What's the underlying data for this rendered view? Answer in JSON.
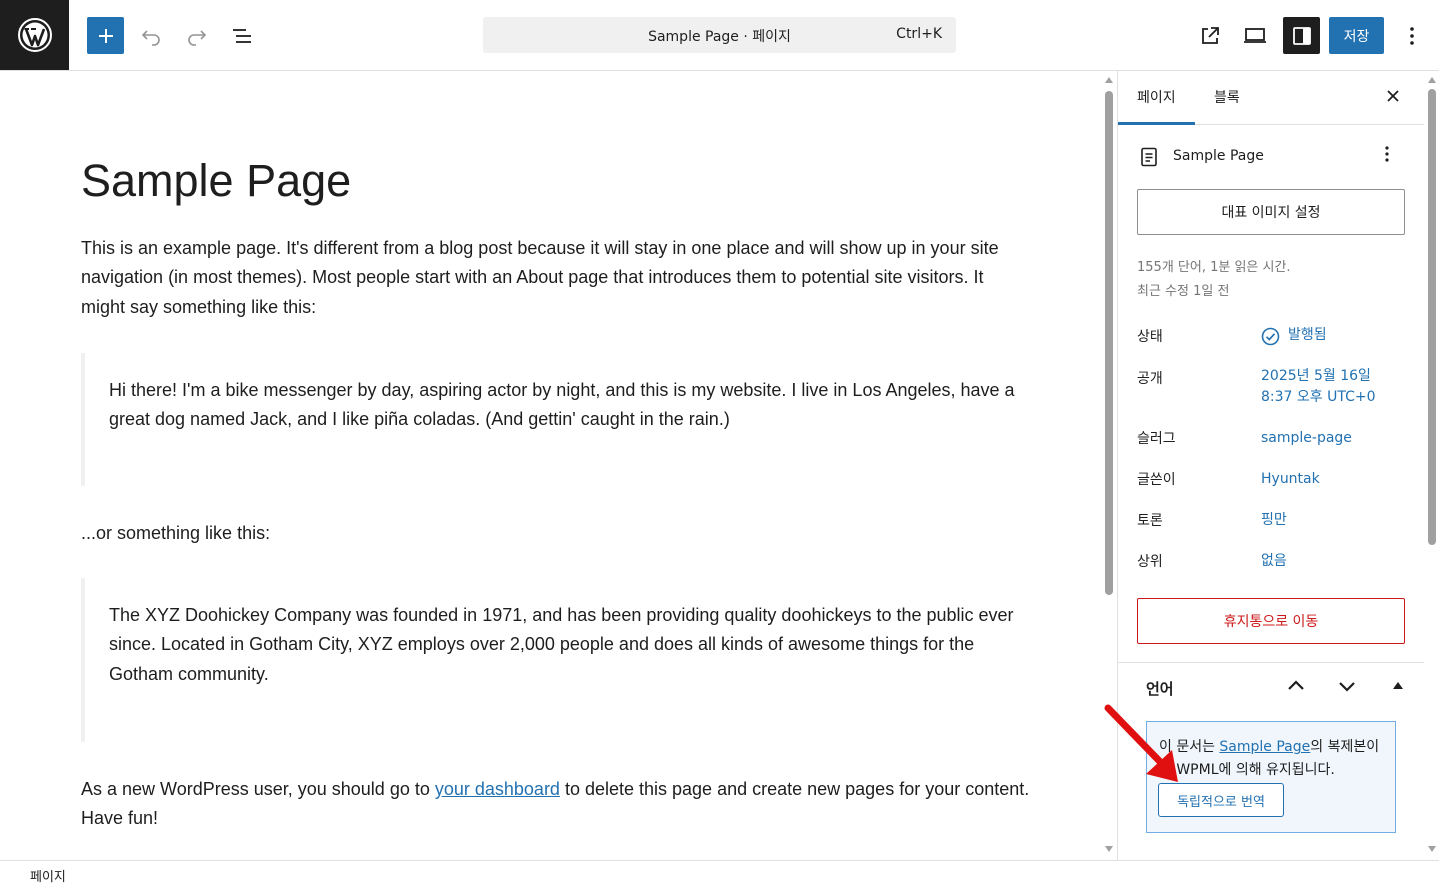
{
  "toolbar": {
    "command_title": "Sample Page · 페이지",
    "command_shortcut": "Ctrl+K",
    "save_label": "저장"
  },
  "content": {
    "title": "Sample Page",
    "para1": "This is an example page. It's different from a blog post because it will stay in one place and will show up in your site navigation (in most themes). Most people start with an About page that introduces them to potential site visitors. It might say something like this:",
    "quote1": "Hi there! I'm a bike messenger by day, aspiring actor by night, and this is my website. I live in Los Angeles, have a great dog named Jack, and I like piña coladas. (And gettin' caught in the rain.)",
    "para2": "...or something like this:",
    "quote2": "The XYZ Doohickey Company was founded in 1971, and has been providing quality doohickeys to the public ever since. Located in Gotham City, XYZ employs over 2,000 people and does all kinds of awesome things for the Gotham community.",
    "para3_before": "As a new WordPress user, you should go to ",
    "para3_link": "your dashboard",
    "para3_after": " to delete this page and create new pages for your content. Have fun!"
  },
  "sidebar": {
    "tabs": [
      {
        "label": "페이지",
        "active": true
      },
      {
        "label": "블록",
        "active": false
      }
    ],
    "doc_title": "Sample Page",
    "featured_image_label": "대표 이미지 설정",
    "meta_words": "155개 단어, 1분 읽은 시간.",
    "meta_modified": "최근 수정 1일 전",
    "rows": [
      {
        "label": "상태",
        "value": "발행됨"
      },
      {
        "label": "공개",
        "value": "2025년 5월 16일 8:37 오후 UTC+0"
      },
      {
        "label": "슬러그",
        "value": "sample-page"
      },
      {
        "label": "글쓴이",
        "value": "Hyuntak"
      },
      {
        "label": "토론",
        "value": "핑만"
      },
      {
        "label": "상위",
        "value": "없음"
      }
    ],
    "publish_date_line1": "2025년 5월 16일",
    "publish_date_line2": "8:37 오후 UTC+0",
    "trash_label": "휴지통으로 이동",
    "language": {
      "title": "언어",
      "notice_prefix": "이 문서는 ",
      "notice_link": "Sample Page",
      "notice_suffix": "의 복제본이며 WPML에 의해 유지됩니다.",
      "translate_button": "독립적으로 번역"
    }
  },
  "footer": {
    "breadcrumb": "페이지"
  },
  "colors": {
    "accent": "#2271b1",
    "danger": "#cc1818",
    "annotation": "#e01010"
  }
}
